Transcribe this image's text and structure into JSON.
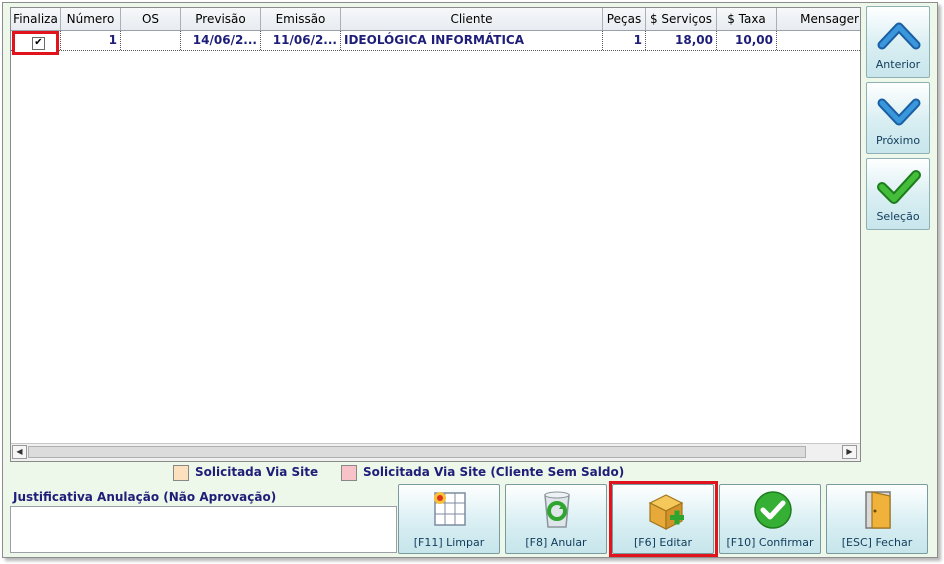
{
  "grid": {
    "columns": [
      "Finaliza",
      "Número",
      "OS",
      "Previsão",
      "Emissão",
      "Cliente",
      "Peças",
      "$ Serviços",
      "$ Taxa",
      "Mensager"
    ],
    "rows": [
      {
        "finaliza": "✔",
        "numero": "1",
        "os": "",
        "previsao": "14/06/2...",
        "emissao": "11/06/2...",
        "cliente": "IDEOLÓGICA INFORMÁTICA",
        "pecas": "1",
        "servicos": "18,00",
        "taxa": "10,00",
        "mensagem": ""
      }
    ]
  },
  "scroll": {
    "left_arrow": "◀",
    "right_arrow": "▶"
  },
  "nav": {
    "anterior": "Anterior",
    "proximo": "Próximo",
    "selecao": "Seleção"
  },
  "legend": {
    "site": {
      "label": "Solicitada Via Site",
      "color": "#fde0bd"
    },
    "site_sem_saldo": {
      "label": "Solicitada Via Site (Cliente Sem Saldo)",
      "color": "#f7c2c8"
    }
  },
  "justificativa": {
    "label": "Justificativa Anulação (Não Aprovação)",
    "value": ""
  },
  "actions": {
    "limpar": "[F11] Limpar",
    "anular": "[F8] Anular",
    "editar": "[F6] Editar",
    "confirmar": "[F10] Confirmar",
    "fechar": "[ESC] Fechar"
  },
  "colors": {
    "accent_red": "#e1141d",
    "text_blue": "#1e1e78",
    "nav_blue": "#2a7fc4",
    "check_green": "#2ea52e"
  }
}
